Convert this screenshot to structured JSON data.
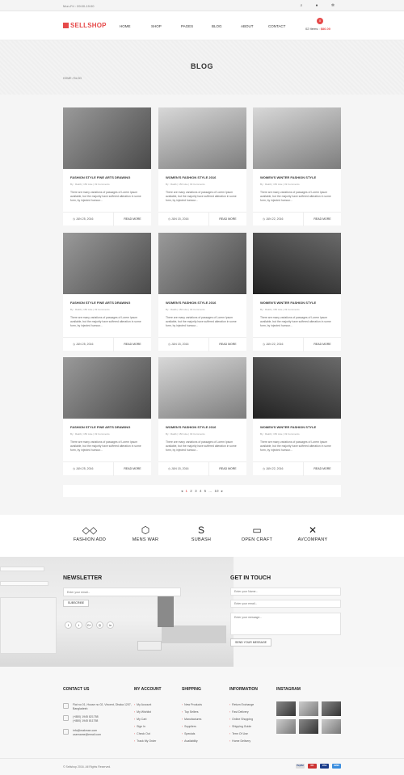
{
  "topbar": {
    "hours": "Mon-Fri : 09:00-19:00",
    "icons": [
      "search-icon",
      "user-icon",
      "gear-icon"
    ]
  },
  "header": {
    "logo": "SELLSHOP",
    "nav": [
      "HOME",
      "SHOP",
      "PAGES",
      "BLOG",
      "ABOUT",
      "CONTACT"
    ],
    "cart": {
      "count": "0",
      "label": "02 Items : ",
      "total": "$86.00"
    }
  },
  "banner": {
    "title": "BLOG",
    "breadcrumb": "HOME  /  BLOG"
  },
  "posts": [
    {
      "title": "FASHION STYLE FINE ARTS DRAWING",
      "meta": "By : Rakib | 150 Like | 49 Comments",
      "excerpt": "There are many variations of passages of Lorem Ipsum available, but the majority have suffered alteration in some form, by injected humour...",
      "date": "JUN 25, 2016",
      "more": "READ MORE"
    },
    {
      "title": "WOMEN'S FASHION STYLE 2016",
      "meta": "By : Rakib | 150 Like | 49 Comments",
      "excerpt": "There are many variations of passages of Lorem Ipsum available, but the majority have suffered alteration in some form, by injected humour...",
      "date": "JUN 15, 2016",
      "more": "READ MORE"
    },
    {
      "title": "WOMEN'S WINTER FASHION STYLE",
      "meta": "By : Rakib | 150 Like | 49 Comments",
      "excerpt": "There are many variations of passages of Lorem Ipsum available, but the majority have suffered alteration in some form, by injected humour...",
      "date": "JUN 22, 2016",
      "more": "READ MORE"
    },
    {
      "title": "FASHION STYLE FINE ARTS DRAWING",
      "meta": "By : Rakib | 150 Like | 49 Comments",
      "excerpt": "There are many variations of passages of Lorem Ipsum available, but the majority have suffered alteration in some form, by injected humour...",
      "date": "JUN 25, 2016",
      "more": "READ MORE"
    },
    {
      "title": "WOMEN'S FASHION STYLE 2016",
      "meta": "By : Rakib | 150 Like | 49 Comments",
      "excerpt": "There are many variations of passages of Lorem Ipsum available, but the majority have suffered alteration in some form, by injected humour...",
      "date": "JUN 15, 2016",
      "more": "READ MORE"
    },
    {
      "title": "WOMEN'S WINTER FASHION STYLE",
      "meta": "By : Rakib | 150 Like | 49 Comments",
      "excerpt": "There are many variations of passages of Lorem Ipsum available, but the majority have suffered alteration in some form, by injected humour...",
      "date": "JUN 22, 2016",
      "more": "READ MORE"
    },
    {
      "title": "FASHION STYLE FINE ARTS DRAWING",
      "meta": "By : Rakib | 150 Like | 49 Comments",
      "excerpt": "There are many variations of passages of Lorem Ipsum available, but the majority have suffered alteration in some form, by injected humour...",
      "date": "JUN 25, 2016",
      "more": "READ MORE"
    },
    {
      "title": "WOMEN'S FASHION STYLE 2016",
      "meta": "By : Rakib | 150 Like | 49 Comments",
      "excerpt": "There are many variations of passages of Lorem Ipsum available, but the majority have suffered alteration in some form, by injected humour...",
      "date": "JUN 15, 2016",
      "more": "READ MORE"
    },
    {
      "title": "WOMEN'S WINTER FASHION STYLE",
      "meta": "By : Rakib | 150 Like | 49 Comments",
      "excerpt": "There are many variations of passages of Lorem Ipsum available, but the majority have suffered alteration in some form, by injected humour...",
      "date": "JUN 22, 2016",
      "more": "READ MORE"
    }
  ],
  "pagination": {
    "prev": "◂",
    "pages": [
      "1",
      "2",
      "3",
      "4",
      "5",
      "...",
      "10"
    ],
    "next": "▸",
    "current": "1"
  },
  "brands": [
    {
      "name": "FASHION ADD",
      "glyph": "◇◇"
    },
    {
      "name": "MENS WAR",
      "glyph": "⬡"
    },
    {
      "name": "SUBASH",
      "glyph": "S"
    },
    {
      "name": "OPEN CRAFT",
      "glyph": "▭"
    },
    {
      "name": "AVCOMPANY",
      "glyph": "✕"
    }
  ],
  "newsletter": {
    "title": "NEWSLETTER",
    "placeholder": "Enter your email...",
    "button": "SUBSCRIBE",
    "social": [
      "f",
      "t",
      "G+",
      "◎",
      "in"
    ]
  },
  "get_in_touch": {
    "title": "GET IN TOUCH",
    "name_placeholder": "Enter your Name...",
    "email_placeholder": "Enter your email...",
    "message_placeholder": "Enter your message...",
    "button": "SEND YOUR MESSAGE"
  },
  "footer": {
    "contact": {
      "title": "CONTACT US",
      "address": "Flat no 01, House no 02, Vincent, Dhaka 1207, Bangladesh",
      "phone1": "(+880) 1945 821758",
      "phone2": "(+880) 1945 811758",
      "email1": "info@makman.com",
      "email2": "username@email.com"
    },
    "account": {
      "title": "MY ACCOUNT",
      "items": [
        "My Account",
        "My Wishlist",
        "My Cart",
        "Sign In",
        "Check Out",
        "Track My Order"
      ]
    },
    "shipping": {
      "title": "SHIPPING",
      "items": [
        "New Products",
        "Top Sellers",
        "Manufactures",
        "Suppliers",
        "Specials",
        "Availability"
      ]
    },
    "information": {
      "title": "INFORMATION",
      "items": [
        "Return Exchange",
        "Fast Delivery",
        "Online Shopping",
        "Shipping Guide",
        "Term Of Use",
        "Home Delivery"
      ]
    },
    "instagram": {
      "title": "INSTAGRAM"
    }
  },
  "copyright": "© Sellshop 2016. All Rights Reserved.",
  "payments": [
    "PayPal",
    "MC",
    "VISA",
    "AMEX"
  ],
  "colors": {
    "accent": "#e64a4a"
  }
}
